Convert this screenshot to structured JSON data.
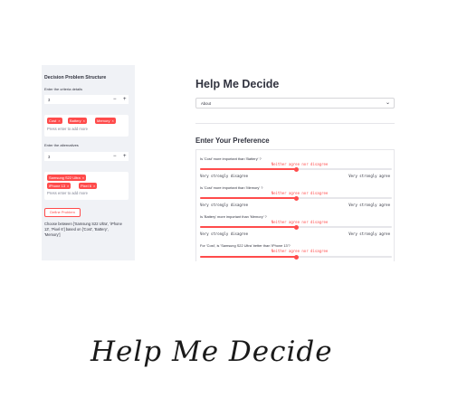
{
  "sidebar": {
    "title": "Decision Problem Structure",
    "criteria_label": "Enter the criteria details",
    "criteria_count": "3",
    "criteria_tags": [
      "Cost",
      "Battery",
      "Memory"
    ],
    "alternatives_label": "Enter the alternatives",
    "alternatives_count": "3",
    "alternative_tags": [
      "Samsung S22 Ultra",
      "iPhone 13",
      "Pixel 6"
    ],
    "multiselect_placeholder": "Press enter to add more",
    "minus": "−",
    "plus": "+",
    "remove_glyph": "×",
    "define_button": "Define Problem",
    "choose_text": "Choose between ['Samsung S22 Ultra', 'iPhone 13', 'Pixel 6'] based on ['Cost', 'Battery', 'Memory']"
  },
  "main": {
    "title": "Help Me Decide",
    "select_value": "About",
    "chevron": "⌄",
    "section_title": "Enter Your Preference",
    "questions": [
      {
        "label": "Is 'Cost' more important than 'Battery' ?",
        "current": "Neither agree nor disagree",
        "min": "Very strongly disagree",
        "max": "Very strongly agree",
        "level": 0.5
      },
      {
        "label": "Is 'Cost' more important than 'Memory' ?",
        "current": "Neither agree nor disagree",
        "min": "Very strongly disagree",
        "max": "Very strongly agree",
        "level": 0.5
      },
      {
        "label": "Is 'Battery' more important than 'Memory' ?",
        "current": "Neither agree nor disagree",
        "min": "Very strongly disagree",
        "max": "Very strongly agree",
        "level": 0.5
      },
      {
        "label": "For 'Cost', is 'Samsung S22 Ultra' better than 'iPhone 13'?",
        "current": "Neither agree nor disagree",
        "level": 0.5
      }
    ]
  },
  "caption": "Help Me Decide",
  "colors": {
    "accent": "#ff4b4b",
    "sidebar_bg": "#f0f2f6",
    "text": "#31333f"
  }
}
